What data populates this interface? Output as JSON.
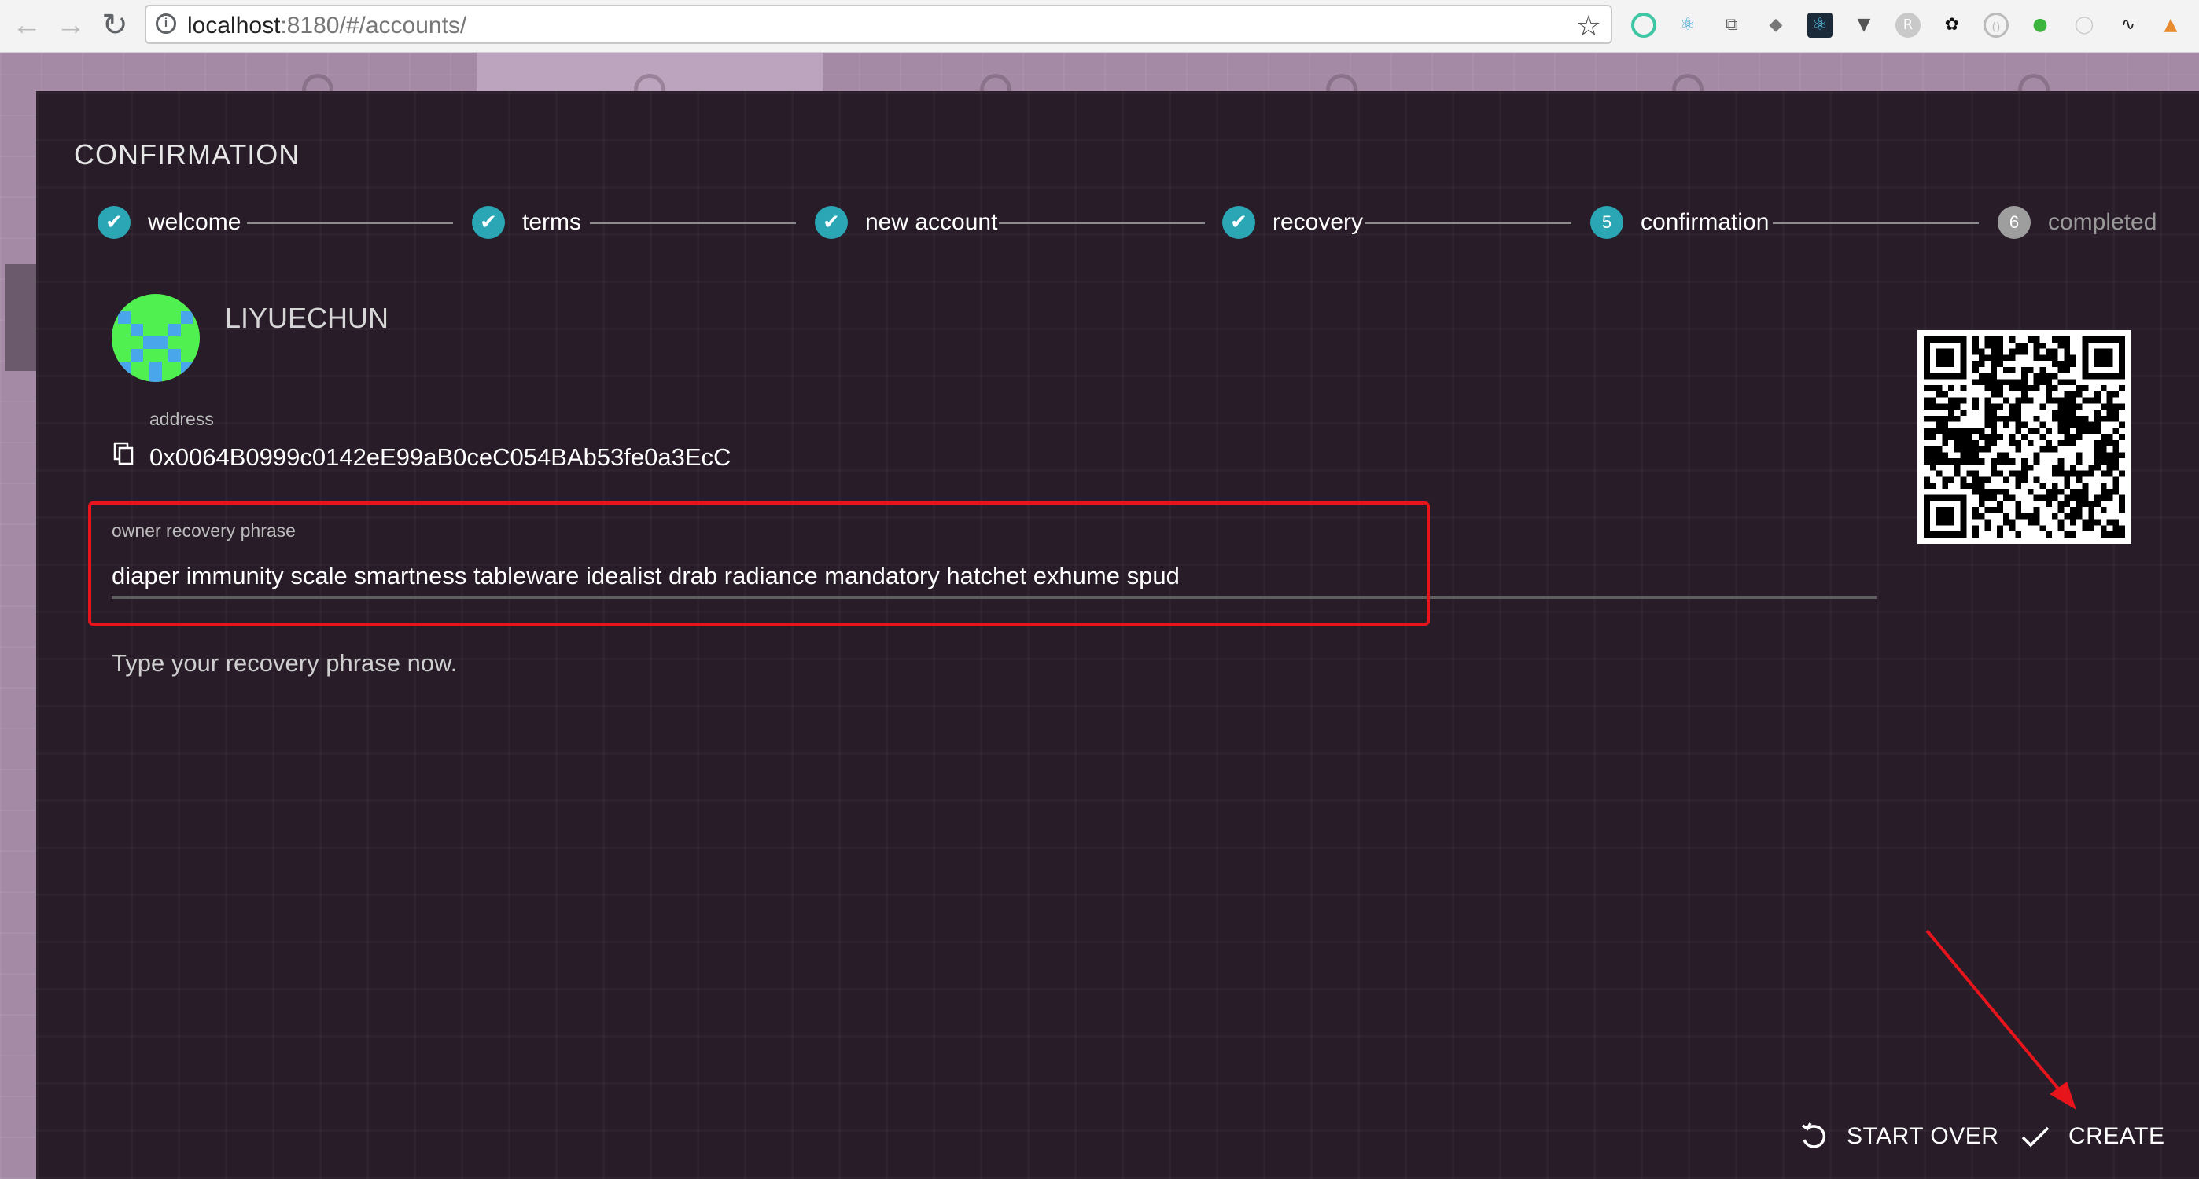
{
  "browser": {
    "url_host": "localhost",
    "url_path": ":8180/#/accounts/"
  },
  "modal": {
    "title": "CONFIRMATION",
    "steps": [
      {
        "label": "welcome",
        "state": "done"
      },
      {
        "label": "terms",
        "state": "done"
      },
      {
        "label": "new account",
        "state": "done"
      },
      {
        "label": "recovery",
        "state": "done"
      },
      {
        "label": "confirmation",
        "state": "active",
        "number": "5"
      },
      {
        "label": "completed",
        "state": "pending",
        "number": "6"
      }
    ]
  },
  "account": {
    "name": "LIYUECHUN",
    "address_label": "address",
    "address": "0x0064B0999c0142eE99aB0ceC054BAb53fe0a3EcC"
  },
  "recovery": {
    "label": "owner recovery phrase",
    "phrase": "diaper immunity scale smartness tableware idealist drab radiance mandatory hatchet exhume spud",
    "hint": "Type your recovery phrase now."
  },
  "buttons": {
    "start_over": "START OVER",
    "create": "CREATE"
  },
  "colors": {
    "step_done": "#2aa6b5",
    "step_pending": "#9e9e9e",
    "annotation": "#e8141c",
    "modal_bg": "#271c27"
  },
  "icons": {
    "step_done": "check-circle-icon",
    "copy": "copy-icon",
    "start_over": "undo-icon",
    "create": "check-icon"
  }
}
